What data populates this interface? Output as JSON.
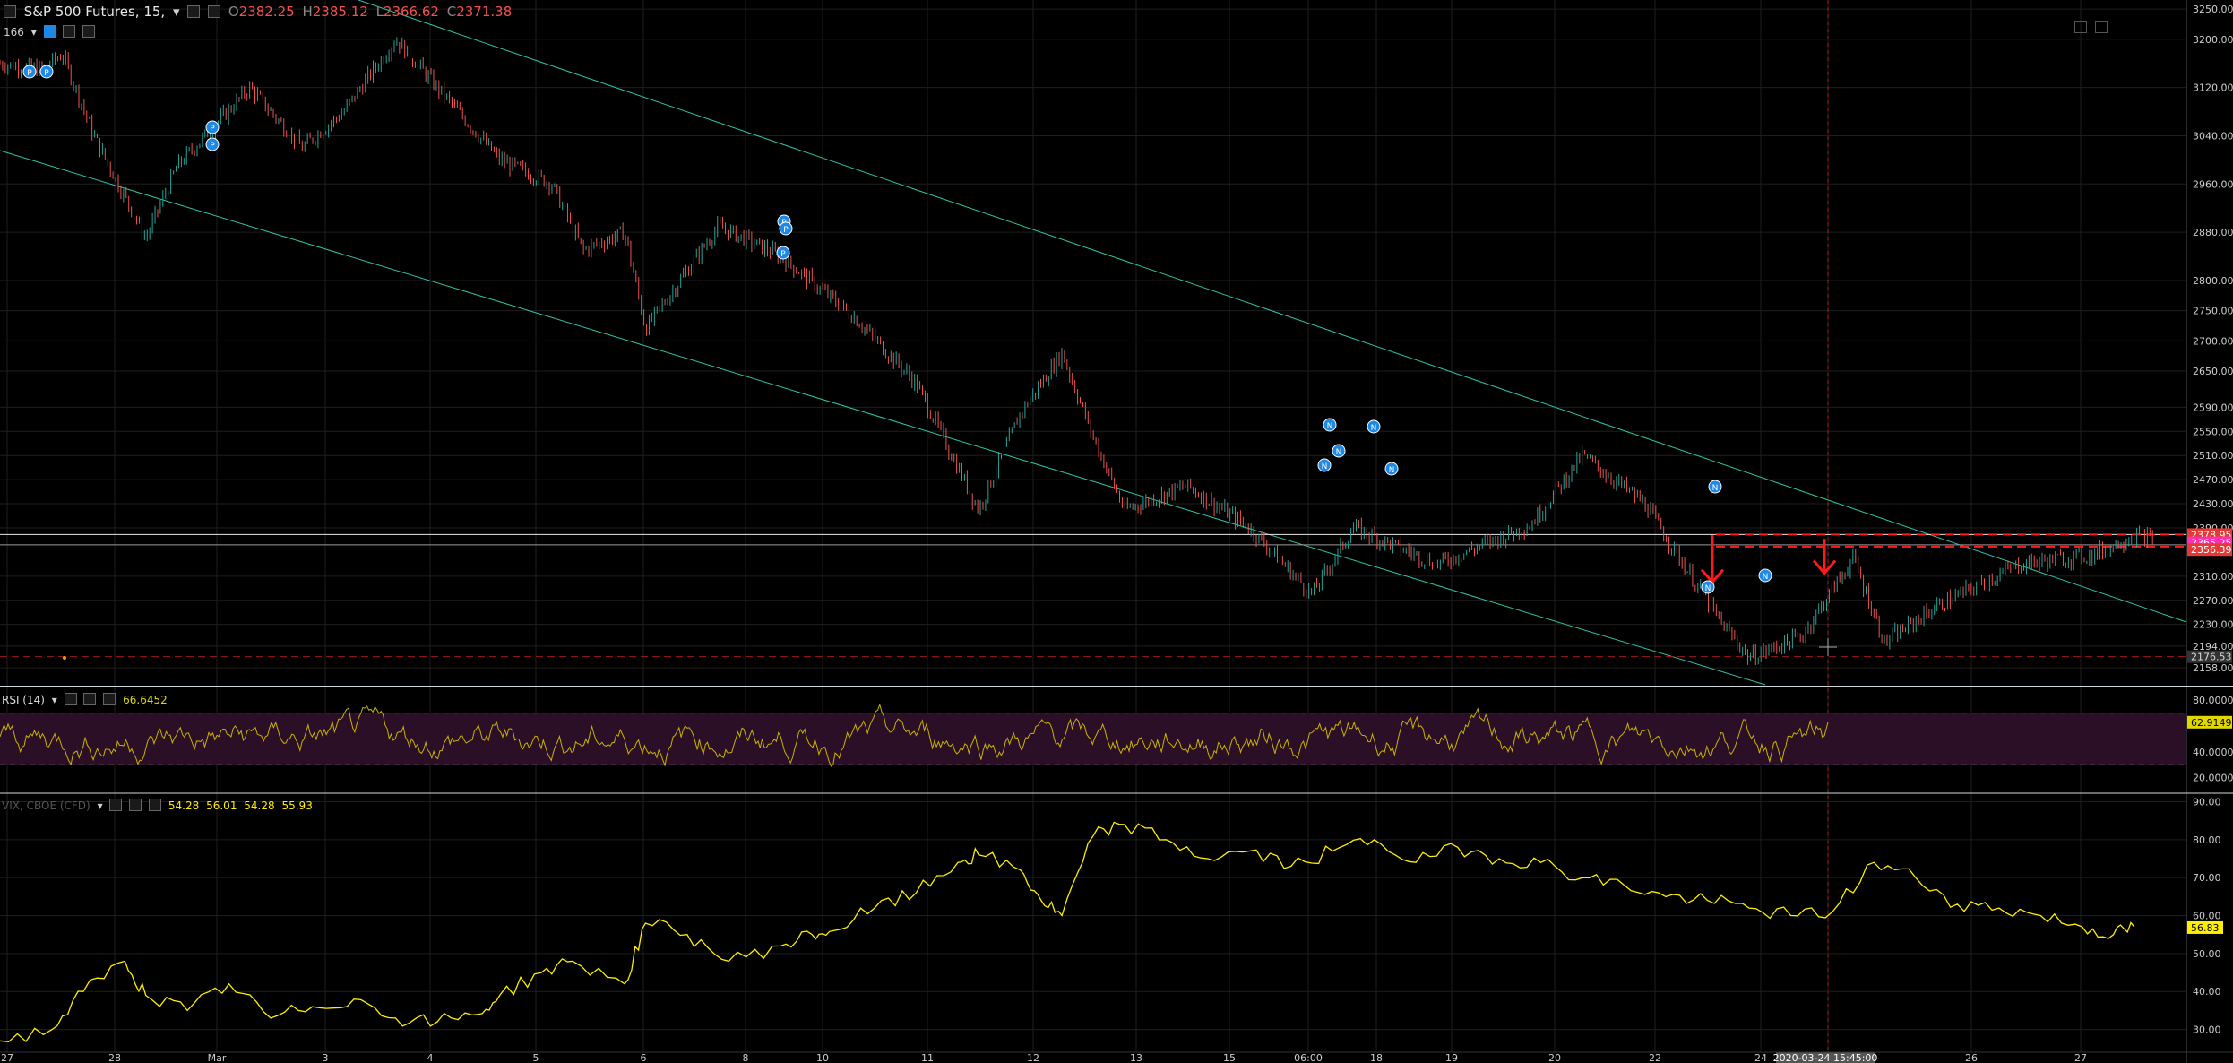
{
  "header": {
    "title": "S&P 500 Futures, 15,",
    "ohlc": [
      {
        "k": "O",
        "v": "2382.25"
      },
      {
        "k": "H",
        "v": "2385.12"
      },
      {
        "k": "L",
        "v": "2366.62"
      },
      {
        "k": "C",
        "v": "2371.38"
      }
    ],
    "sub": "166"
  },
  "rsi_legend": {
    "name": "RSI (14)",
    "value": "66.6452"
  },
  "vix_legend": {
    "name": "VIX, CBOE (CFD)",
    "values": [
      "54.28",
      "56.01",
      "54.28",
      "55.93"
    ]
  },
  "colors": {
    "up": "#26a69a",
    "down": "#ef5350",
    "channel": "#2ec4a6",
    "rsi": "#c8b400",
    "vix": "#ffee00",
    "grid": "#1e1e1e",
    "marker": "#1e88e5",
    "pink": "#ff2fb1",
    "red": "#ff1a1a"
  },
  "chart_data": [
    {
      "type": "candlestick",
      "title": "S&P 500 Futures, 15,",
      "ylim": [
        2130,
        3265
      ],
      "y_ticks": [
        "3250.00",
        "3200.00",
        "3120.00",
        "3040.00",
        "2960.00",
        "2880.00",
        "2800.00",
        "2750.00",
        "2700.00",
        "2650.00",
        "2590.00",
        "2550.00",
        "2510.00",
        "2470.00",
        "2430.00",
        "2390.00",
        "2310.00",
        "2270.00",
        "2230.00",
        "2194.00",
        "2158.00"
      ],
      "x_ticks": [
        "27",
        "28",
        "Mar",
        "3",
        "4",
        "5",
        "6",
        "8",
        "10",
        "11",
        "12",
        "13",
        "15",
        "06:00",
        "18",
        "19",
        "20",
        "22",
        "24",
        "2020-03-24 15:45:00",
        "26",
        "27"
      ],
      "path": [
        {
          "x": 0,
          "y": 3160
        },
        {
          "x": 4,
          "y": 3150
        },
        {
          "x": 6,
          "y": 3175
        },
        {
          "x": 9,
          "y": 3040
        },
        {
          "x": 14,
          "y": 2870
        },
        {
          "x": 17,
          "y": 2990
        },
        {
          "x": 24,
          "y": 3120
        },
        {
          "x": 29,
          "y": 3020
        },
        {
          "x": 33,
          "y": 3080
        },
        {
          "x": 38,
          "y": 3200
        },
        {
          "x": 48,
          "y": 3000
        },
        {
          "x": 53,
          "y": 2960
        },
        {
          "x": 56,
          "y": 2850
        },
        {
          "x": 60,
          "y": 2880
        },
        {
          "x": 62,
          "y": 2720
        },
        {
          "x": 69,
          "y": 2890
        },
        {
          "x": 75,
          "y": 2840
        },
        {
          "x": 82,
          "y": 2740
        },
        {
          "x": 88,
          "y": 2630
        },
        {
          "x": 94,
          "y": 2420
        },
        {
          "x": 98,
          "y": 2580
        },
        {
          "x": 102,
          "y": 2680
        },
        {
          "x": 105,
          "y": 2540
        },
        {
          "x": 108,
          "y": 2420
        },
        {
          "x": 114,
          "y": 2460
        },
        {
          "x": 120,
          "y": 2390
        },
        {
          "x": 126,
          "y": 2280
        },
        {
          "x": 130,
          "y": 2390
        },
        {
          "x": 138,
          "y": 2330
        },
        {
          "x": 147,
          "y": 2395
        },
        {
          "x": 152,
          "y": 2510
        },
        {
          "x": 158,
          "y": 2430
        },
        {
          "x": 165,
          "y": 2240
        },
        {
          "x": 168,
          "y": 2175
        },
        {
          "x": 173,
          "y": 2210
        },
        {
          "x": 178,
          "y": 2340
        },
        {
          "x": 181,
          "y": 2200
        },
        {
          "x": 186,
          "y": 2260
        },
        {
          "x": 194,
          "y": 2330
        },
        {
          "x": 201,
          "y": 2345
        },
        {
          "x": 205,
          "y": 2378
        },
        {
          "x": 207,
          "y": 2371
        }
      ],
      "price_labels": [
        "2378.95",
        "2365.25",
        "2356.39",
        "2176.53"
      ]
    },
    {
      "type": "line",
      "title": "RSI (14)",
      "ylim": [
        10,
        85
      ],
      "y_ticks": [
        "80.0000",
        "62.9149",
        "40.0000",
        "20.0000"
      ],
      "value_label": "62.9149"
    },
    {
      "type": "line",
      "title": "VIX, CBOE (CFD)",
      "ylim": [
        24,
        92
      ],
      "y_ticks": [
        "90.00",
        "80.00",
        "70.00",
        "60.00",
        "50.00",
        "40.00",
        "30.00"
      ],
      "value_label": "56.83",
      "x": [
        0,
        5,
        8,
        12,
        14,
        18,
        22,
        26,
        30,
        34,
        38,
        42,
        46,
        48,
        52,
        55,
        60,
        62,
        66,
        70,
        75,
        78,
        80,
        84,
        88,
        92,
        94,
        98,
        100,
        102,
        105,
        108,
        112,
        116,
        120,
        124,
        128,
        132,
        136,
        140,
        144,
        148,
        152,
        156,
        160,
        164,
        168,
        172,
        176,
        180,
        184,
        188,
        192,
        196,
        200,
        203,
        205
      ],
      "values": [
        27,
        30,
        40,
        48,
        39,
        35,
        42,
        33,
        36,
        38,
        33,
        32,
        34,
        39,
        45,
        48,
        42,
        58,
        55,
        48,
        52,
        55,
        56,
        62,
        66,
        74,
        76,
        72,
        64,
        60,
        81,
        84,
        80,
        75,
        77,
        73,
        77,
        80,
        74,
        78,
        75,
        74,
        70,
        68,
        65,
        64,
        62,
        60,
        61,
        74,
        70,
        63,
        62,
        60,
        57,
        55,
        57
      ]
    }
  ],
  "markers": {
    "p": "P",
    "n": "N"
  }
}
